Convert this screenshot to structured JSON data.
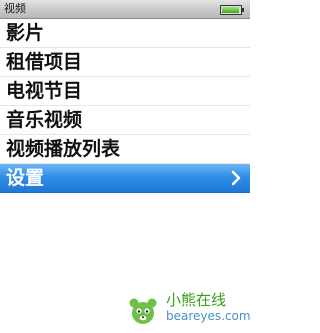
{
  "status_bar": {
    "title": "视频",
    "battery_level": 0.95
  },
  "menu": {
    "items": [
      {
        "label": "影片",
        "selected": false
      },
      {
        "label": "租借项目",
        "selected": false
      },
      {
        "label": "电视节目",
        "selected": false
      },
      {
        "label": "音乐视频",
        "selected": false
      },
      {
        "label": "视频播放列表",
        "selected": false
      },
      {
        "label": "设置",
        "selected": true
      }
    ]
  },
  "watermark": {
    "name": "小熊在线",
    "site": "beareyes.com"
  },
  "colors": {
    "selection": "#2f8ee8",
    "watermark_green": "#3aa01a",
    "watermark_blue": "#4a90c8"
  }
}
